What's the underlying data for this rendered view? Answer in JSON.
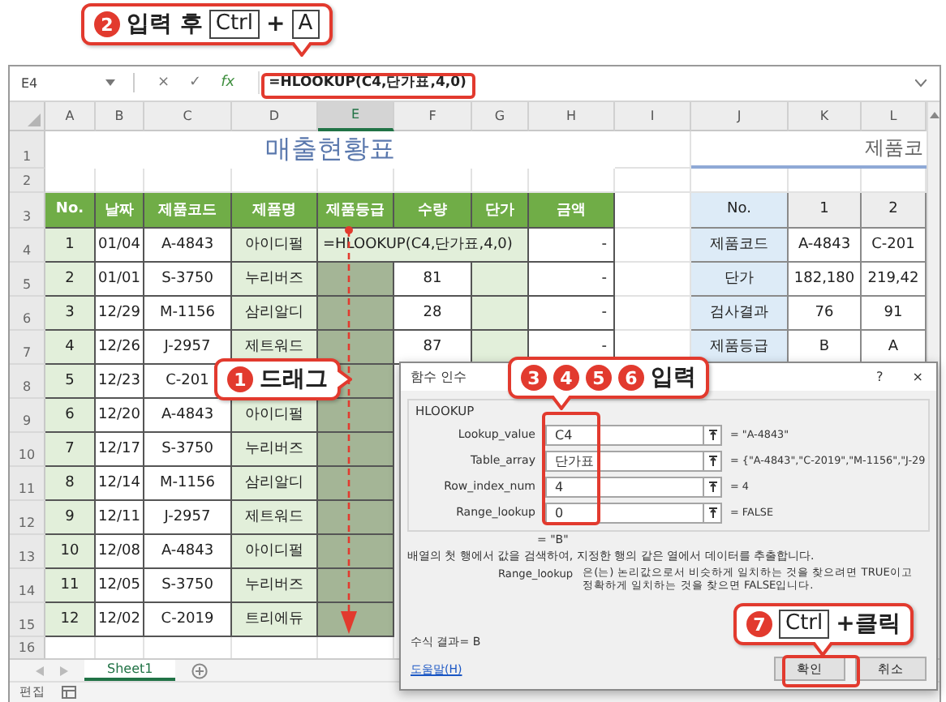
{
  "callouts": [
    {
      "parts": [
        {
          "kind": "badge",
          "text": "2"
        },
        {
          "kind": "text",
          "text": "입력 후"
        },
        {
          "kind": "key",
          "text": "Ctrl"
        },
        {
          "kind": "text",
          "text": "+"
        },
        {
          "kind": "key",
          "text": "A"
        }
      ]
    },
    {
      "parts": [
        {
          "kind": "badge",
          "text": "1"
        },
        {
          "kind": "text",
          "text": "드래그"
        }
      ]
    },
    {
      "parts": [
        {
          "kind": "badge",
          "text": "3"
        },
        {
          "kind": "badge",
          "text": "4"
        },
        {
          "kind": "badge",
          "text": "5"
        },
        {
          "kind": "badge",
          "text": "6"
        },
        {
          "kind": "text",
          "text": "입력"
        }
      ]
    },
    {
      "parts": [
        {
          "kind": "badge",
          "text": "7"
        },
        {
          "kind": "key",
          "text": "Ctrl"
        },
        {
          "kind": "text",
          "text": "+클릭"
        }
      ]
    }
  ],
  "formula_bar": {
    "name_box": "E4",
    "buttons": [
      "×",
      "✓",
      "fx"
    ],
    "formula": "=HLOOKUP(C4,단가표,4,0)"
  },
  "sheet": {
    "columns": [
      {
        "label": "A",
        "selected": false
      },
      {
        "label": "B",
        "selected": false
      },
      {
        "label": "C",
        "selected": false
      },
      {
        "label": "D",
        "selected": false
      },
      {
        "label": "E",
        "selected": true
      },
      {
        "label": "F",
        "selected": false
      },
      {
        "label": "G",
        "selected": false
      },
      {
        "label": "H",
        "selected": false
      },
      {
        "label": "I",
        "selected": false
      },
      {
        "label": "J",
        "selected": false
      },
      {
        "label": "K",
        "selected": false
      },
      {
        "label": "L",
        "selected": false
      }
    ],
    "row_numbers": [
      "1",
      "2",
      "3",
      "4",
      "5",
      "6",
      "7",
      "8",
      "9",
      "10",
      "11",
      "12",
      "13",
      "14",
      "15",
      "16"
    ],
    "title": "매출현황표",
    "side_title": "제품코",
    "main_table": {
      "headers": [
        "No.",
        "날짜",
        "제품코드",
        "제품명",
        "제품등급",
        "수량",
        "단가",
        "금액"
      ],
      "rows": [
        {
          "no": "1",
          "date": "01/04",
          "code": "A-4843",
          "name": "아이디펄",
          "formula": "=HLOOKUP(C4,단가표,4,0)",
          "grade_selected": false,
          "amount": "-"
        },
        {
          "no": "2",
          "date": "01/01",
          "code": "S-3750",
          "name": "누리버즈",
          "grade_selected": true,
          "quantity": "81",
          "amount": "-"
        },
        {
          "no": "3",
          "date": "12/29",
          "code": "M-1156",
          "name": "삼리알디",
          "grade_selected": true,
          "quantity": "28",
          "amount": "-"
        },
        {
          "no": "4",
          "date": "12/26",
          "code": "J-2957",
          "name": "제트워드",
          "grade_selected": true,
          "quantity": "87",
          "amount": "-"
        },
        {
          "no": "5",
          "date": "12/23",
          "code": "C-201",
          "grade_selected": true
        },
        {
          "no": "6",
          "date": "12/20",
          "code": "A-4843",
          "name": "아이디펄",
          "grade_selected": true
        },
        {
          "no": "7",
          "date": "12/17",
          "code": "S-3750",
          "name": "누리버즈",
          "grade_selected": true
        },
        {
          "no": "8",
          "date": "12/14",
          "code": "M-1156",
          "name": "삼리알디",
          "grade_selected": true
        },
        {
          "no": "9",
          "date": "12/11",
          "code": "J-2957",
          "name": "제트워드",
          "grade_selected": true
        },
        {
          "no": "10",
          "date": "12/08",
          "code": "A-4843",
          "name": "아이디펄",
          "grade_selected": true
        },
        {
          "no": "11",
          "date": "12/05",
          "code": "S-3750",
          "name": "누리버즈",
          "grade_selected": true
        },
        {
          "no": "12",
          "date": "12/02",
          "code": "C-2019",
          "name": "트리에듀",
          "grade_selected": true
        }
      ]
    },
    "right_table": {
      "rows": [
        [
          "No.",
          "1",
          "2"
        ],
        [
          "제품코드",
          "A-4843",
          "C-201"
        ],
        [
          "단가",
          "182,180",
          "219,42"
        ],
        [
          "검사결과",
          "76",
          "91"
        ],
        [
          "제품등급",
          "B",
          "A"
        ]
      ]
    }
  },
  "tabs": [
    {
      "label": "Sheet1",
      "selected": true
    }
  ],
  "status_bar": {
    "mode": "편집"
  },
  "dialog": {
    "title": "함수 인수",
    "help": "?",
    "close": "×",
    "function": "HLOOKUP",
    "arguments": [
      {
        "label": "Lookup_value",
        "value": "C4",
        "result": "= \"A-4843\""
      },
      {
        "label": "Table_array",
        "value": "단가표",
        "result": "= {\"A-4843\",\"C-2019\",\"M-1156\",\"J-29"
      },
      {
        "label": "Row_index_num",
        "value": "4",
        "result": "= 4"
      },
      {
        "label": "Range_lookup",
        "value": "0",
        "result": "= FALSE"
      }
    ],
    "result": "= \"B\"",
    "description": "배열의 첫 행에서 값을 검색하여, 지정한 행의 같은 열에서 데이터를 추출합니다.",
    "arg_help_label": "Range_lookup",
    "arg_help_lines": [
      "은(는) 논리값으로서 비슷하게 일치하는 것을 찾으려면 TRUE이고",
      "정확하게 일치하는 것을 찾으면 FALSE입니다."
    ],
    "formula_result": "수식 결과= B",
    "help_link": "도움말(H)",
    "buttons": [
      "확인",
      "취소"
    ]
  }
}
